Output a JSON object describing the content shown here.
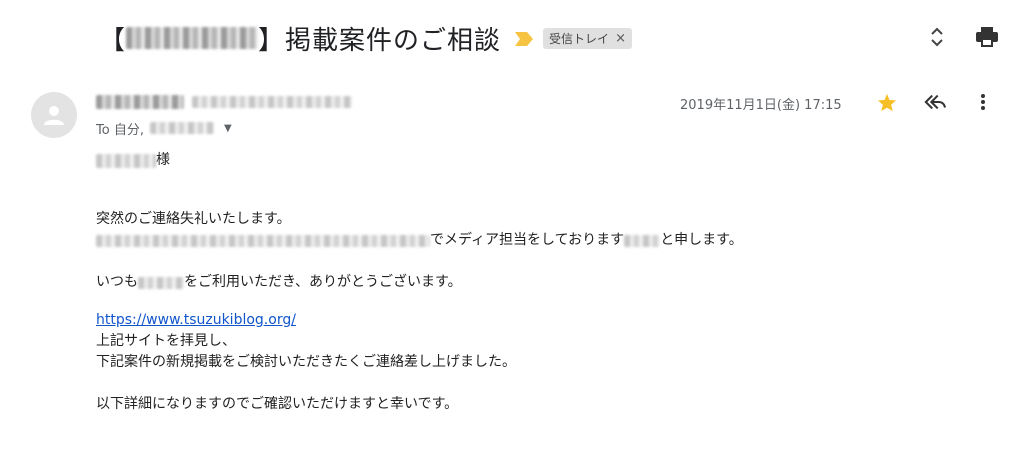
{
  "subject": {
    "bracket_open": "【",
    "bracket_close": "】",
    "title": "掲載案件のご相談",
    "label": "受信トレイ",
    "label_close": "×"
  },
  "toolbar": {
    "icons": [
      "expand-collapse-icon",
      "print-icon"
    ]
  },
  "message": {
    "to_prefix": "To 自分,",
    "date": "2019年11月1日(金) 17:15",
    "icons": [
      "star-icon",
      "reply-icon",
      "more-vert-icon"
    ]
  },
  "body": {
    "greeting_suffix": "様",
    "line1": "突然のご連絡失礼いたします。",
    "line2_tail_a": "でメディア担当をしております",
    "line2_tail_b": "と申します。",
    "line3_a": "いつも",
    "line3_b": "をご利用いただき、ありがとうございます。",
    "link": "https://www.tsuzukiblog.org/",
    "line5": "上記サイトを拝見し、",
    "line6": "下記案件の新規掲載をご検討いただきたくご連絡差し上げました。",
    "line7": "以下詳細になりますのでご確認いただけますと幸いです。"
  },
  "colors": {
    "star": "#f6bf26",
    "label_arrow": "#f6c343",
    "link": "#1155cc"
  }
}
